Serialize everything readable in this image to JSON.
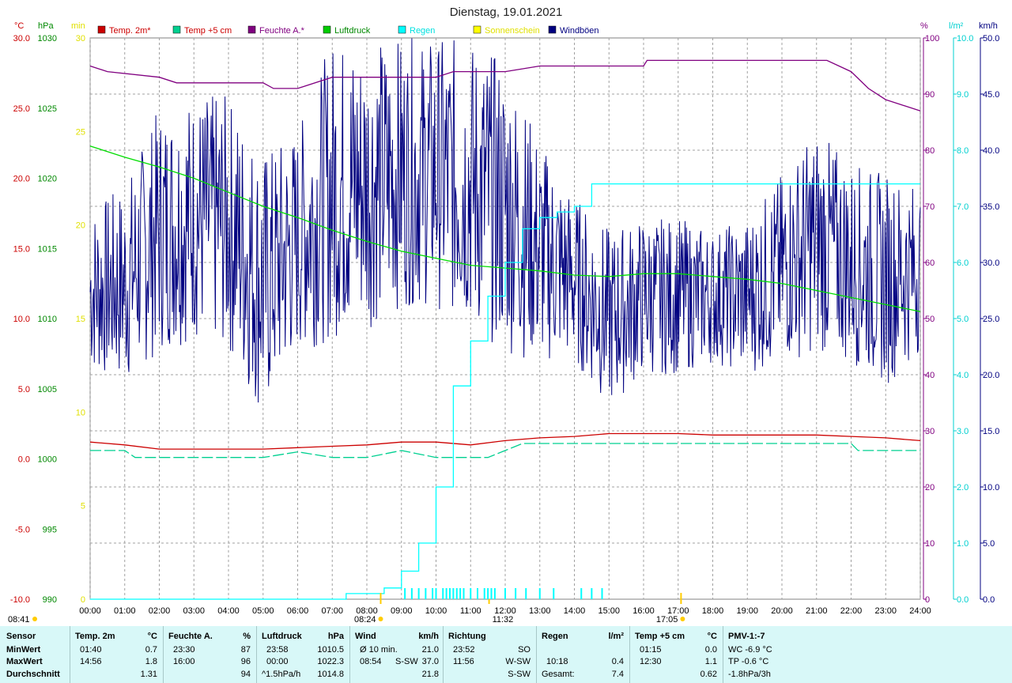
{
  "title": "Dienstag, 19.01.2021",
  "legend": [
    {
      "label": "Temp. 2m*",
      "color": "#cc0000",
      "text_color": "#cc0000"
    },
    {
      "label": "Temp +5 cm",
      "color": "#00d090",
      "text_color": "#cc0000"
    },
    {
      "label": "Feuchte A.*",
      "color": "#800080",
      "text_color": "#800080"
    },
    {
      "label": "Luftdruck",
      "color": "#00cc00",
      "text_color": "#008800"
    },
    {
      "label": "Regen",
      "color": "#00ffff",
      "text_color": "#00e0e0"
    },
    {
      "label": "Sonnenschein",
      "color": "#ffff00",
      "text_color": "#e0e000"
    },
    {
      "label": "Windböen",
      "color": "#000080",
      "text_color": "#000080"
    }
  ],
  "axes": {
    "temp": {
      "unit": "°C",
      "ticks": [
        "30.0",
        "25.0",
        "20.0",
        "15.0",
        "10.0",
        "5.0",
        "0.0",
        "-5.0",
        "-10.0"
      ],
      "color": "#cc0000"
    },
    "pressure": {
      "unit": "hPa",
      "ticks": [
        "1030",
        "1025",
        "1020",
        "1015",
        "1010",
        "1005",
        "1000",
        "995",
        "990"
      ],
      "color": "#008800"
    },
    "sun": {
      "unit": "min",
      "ticks": [
        "30",
        "25",
        "20",
        "15",
        "10",
        "5",
        "0"
      ],
      "color": "#e0e000"
    },
    "humidity": {
      "unit": "%",
      "ticks": [
        "100",
        "90",
        "80",
        "70",
        "60",
        "50",
        "40",
        "30",
        "20",
        "10",
        "0"
      ],
      "color": "#800080"
    },
    "rain": {
      "unit": "l/m²",
      "ticks": [
        "10.0",
        "9.0",
        "8.0",
        "7.0",
        "6.0",
        "5.0",
        "4.0",
        "3.0",
        "2.0",
        "1.0",
        "0.0"
      ],
      "color": "#00d0d0"
    },
    "wind": {
      "unit": "km/h",
      "ticks": [
        "50.0",
        "45.0",
        "40.0",
        "35.0",
        "30.0",
        "25.0",
        "20.0",
        "15.0",
        "10.0",
        "5.0",
        "0.0"
      ],
      "color": "#000080"
    },
    "time_ticks": [
      "00:00",
      "01:00",
      "02:00",
      "03:00",
      "04:00",
      "05:00",
      "06:00",
      "07:00",
      "08:00",
      "09:00",
      "10:00",
      "11:00",
      "12:00",
      "13:00",
      "14:00",
      "15:00",
      "16:00",
      "17:00",
      "18:00",
      "19:00",
      "20:00",
      "21:00",
      "22:00",
      "23:00",
      "24:00"
    ]
  },
  "markers": {
    "sunrise": "08:24",
    "noon": "11:32",
    "sunset": "17:05",
    "now": "08:41"
  },
  "chart_data": {
    "type": "line",
    "title": "Dienstag, 19.01.2021",
    "xlim": [
      0,
      24
    ],
    "series": [
      {
        "name": "Temp. 2m*",
        "axis": "temp",
        "x": [
          0,
          1,
          2,
          3,
          4,
          5,
          6,
          7,
          8,
          9,
          10,
          11,
          12,
          13,
          14,
          15,
          16,
          17,
          18,
          19,
          20,
          21,
          22,
          23,
          24
        ],
        "values": [
          1.2,
          1.0,
          0.7,
          0.7,
          0.7,
          0.7,
          0.8,
          0.9,
          1.0,
          1.2,
          1.2,
          1.0,
          1.3,
          1.5,
          1.6,
          1.8,
          1.8,
          1.8,
          1.7,
          1.7,
          1.7,
          1.7,
          1.6,
          1.5,
          1.3
        ]
      },
      {
        "name": "Temp +5 cm",
        "axis": "temp",
        "x": [
          0,
          1,
          1.3,
          2,
          3,
          4,
          5,
          6,
          7,
          8,
          9,
          10,
          11,
          11.5,
          12,
          12.5,
          13,
          14,
          15,
          16,
          17,
          18,
          19,
          20,
          21,
          22,
          22.2,
          23,
          24
        ],
        "values": [
          0.6,
          0.6,
          0.1,
          0.1,
          0.1,
          0.1,
          0.1,
          0.5,
          0.1,
          0.1,
          0.6,
          0.1,
          0.1,
          0.1,
          0.6,
          1.1,
          1.1,
          1.1,
          1.1,
          1.1,
          1.1,
          1.1,
          1.1,
          1.1,
          1.1,
          1.1,
          0.6,
          0.6,
          0.6
        ]
      },
      {
        "name": "Feuchte A.*",
        "axis": "humidity",
        "x": [
          0,
          0.5,
          2,
          2.5,
          3,
          4,
          4.6,
          5,
          5.3,
          6,
          7,
          8,
          9,
          10,
          10.5,
          11,
          12,
          13,
          14,
          15,
          16,
          16.1,
          17,
          18,
          19,
          20,
          21,
          21.3,
          22,
          22.5,
          23,
          24
        ],
        "values": [
          95,
          94,
          93,
          92,
          92,
          92,
          92,
          92,
          91,
          91,
          93,
          93,
          93,
          93,
          94,
          94,
          94,
          95,
          95,
          95,
          95,
          96,
          96,
          96,
          96,
          96,
          96,
          96,
          94,
          91,
          89,
          87
        ]
      },
      {
        "name": "Luftdruck",
        "axis": "pressure",
        "x": [
          0,
          1,
          2,
          3,
          4,
          5,
          6,
          7,
          8,
          9,
          10,
          11,
          12,
          13,
          14,
          15,
          16,
          17,
          18,
          19,
          20,
          21,
          22,
          23,
          24
        ],
        "values": [
          1022.3,
          1021.5,
          1020.8,
          1020.0,
          1019.0,
          1018.0,
          1017.2,
          1016.3,
          1015.5,
          1014.8,
          1014.3,
          1013.8,
          1013.6,
          1013.4,
          1013.1,
          1013.0,
          1013.2,
          1013.2,
          1013.0,
          1012.8,
          1012.5,
          1012.0,
          1011.5,
          1011.0,
          1010.5
        ]
      },
      {
        "name": "Regen",
        "axis": "rain",
        "x": [
          0,
          7.4,
          8.5,
          9,
          9.5,
          10,
          10.5,
          11,
          11.5,
          12,
          12.5,
          13,
          13.5,
          14,
          14.5,
          15,
          24
        ],
        "values": [
          0.0,
          0.1,
          0.2,
          0.5,
          1.0,
          2.0,
          3.8,
          4.6,
          5.4,
          6.0,
          6.6,
          6.8,
          6.9,
          7.0,
          7.4,
          7.4,
          7.4
        ]
      },
      {
        "name": "Windböen",
        "axis": "wind",
        "x": [
          0,
          1,
          2,
          3,
          4,
          5,
          6,
          7,
          8,
          9,
          10,
          11,
          12,
          13,
          14,
          15,
          16,
          17,
          18,
          19,
          20,
          21,
          22,
          23,
          24
        ],
        "values": [
          27,
          28,
          31,
          30,
          29,
          27,
          30,
          33,
          35,
          37,
          34,
          33,
          30,
          28,
          26,
          25,
          24,
          25,
          24,
          25,
          27,
          30,
          29,
          27,
          28
        ],
        "min": [
          20,
          19,
          22,
          23,
          22,
          16,
          22,
          23,
          24,
          26,
          26,
          24,
          22,
          21,
          21,
          17,
          20,
          20,
          21,
          20,
          21,
          22,
          21,
          19,
          22
        ],
        "max": [
          35,
          37,
          44,
          45,
          45,
          40,
          42,
          50,
          50,
          50,
          50,
          50,
          48,
          41,
          36,
          33,
          34,
          34,
          33,
          34,
          38,
          42,
          39,
          38,
          37
        ]
      },
      {
        "name": "Sonnenschein",
        "axis": "sun",
        "x": [],
        "values": []
      }
    ],
    "rain_ticks_hours": [
      9.1,
      9.3,
      9.5,
      9.7,
      9.9,
      10.0,
      10.2,
      10.3,
      10.4,
      10.5,
      10.6,
      10.7,
      10.8,
      11.0,
      11.2,
      11.4,
      11.5,
      11.6,
      11.7,
      12.0,
      12.3,
      12.6,
      13.0,
      13.4,
      14.2,
      14.5,
      14.8
    ],
    "grid": true
  },
  "footer": {
    "sensor": {
      "h": "Sensor",
      "min": "MinWert",
      "max": "MaxWert",
      "avg": "Durchschnitt"
    },
    "temp2m": {
      "h": "Temp. 2m",
      "unit": "°C",
      "min_t": "01:40",
      "min_v": "0.7",
      "max_t": "14:56",
      "max_v": "1.8",
      "avg_v": "1.31"
    },
    "humidity": {
      "h": "Feuchte A.",
      "unit": "%",
      "min_t": "23:30",
      "min_v": "87",
      "max_t": "16:00",
      "max_v": "96",
      "avg_v": "94"
    },
    "pressure": {
      "h": "Luftdruck",
      "unit": "hPa",
      "min_t": "23:58",
      "min_v": "1010.5",
      "max_t": "00:00",
      "max_v": "1022.3",
      "avg_t": "^1.5hPa/h",
      "avg_v": "1014.8"
    },
    "wind": {
      "h": "Wind",
      "unit": "km/h",
      "min_t": "Ø 10 min.",
      "min_v": "21.0",
      "max_t": "08:54",
      "max_d": "S-SW",
      "max_v": "37.0",
      "avg_v": "21.8"
    },
    "direction": {
      "h": "Richtung",
      "min_t": "23:52",
      "min_v": "SO",
      "max_t": "11:56",
      "max_v": "W-SW",
      "avg_v": "S-SW"
    },
    "rain": {
      "h": "Regen",
      "unit": "l/m²",
      "max_t": "10:18",
      "max_v": "0.4",
      "avg_t": "Gesamt:",
      "avg_v": "7.4"
    },
    "temp5": {
      "h": "Temp +5 cm",
      "unit": "°C",
      "min_t": "01:15",
      "min_v": "0.0",
      "max_t": "12:30",
      "max_v": "1.1",
      "avg_v": "0.62"
    },
    "pmv": {
      "h": "PMV-1:-7",
      "min_v": "WC -6.9 °C",
      "max_v": "TP -0.6 °C",
      "avg_v": "-1.8hPa/3h"
    }
  }
}
